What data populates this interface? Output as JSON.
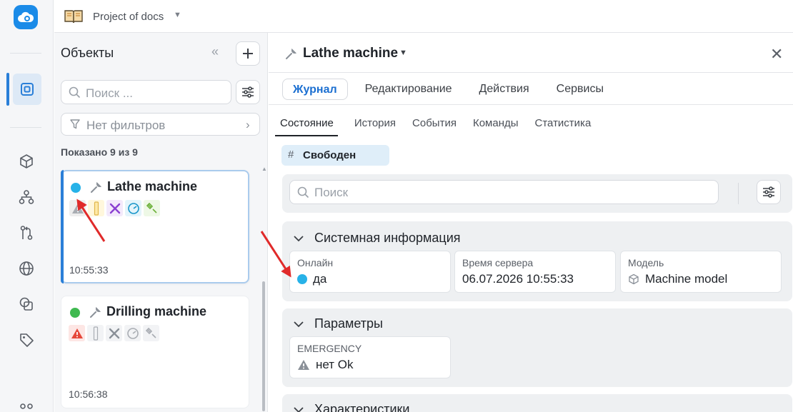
{
  "project": {
    "name": "Project of docs"
  },
  "objects_panel": {
    "title": "Объекты",
    "search_placeholder": "Поиск ...",
    "filters_label": "Нет фильтров",
    "shown_count": "Показано 9 из 9",
    "items": [
      {
        "name": "Lathe machine",
        "time": "10:55:33",
        "status_color": "#27b2e8",
        "selected": true
      },
      {
        "name": "Drilling machine",
        "time": "10:56:38",
        "status_color": "#3fb950",
        "selected": false
      }
    ]
  },
  "detail": {
    "title": "Lathe machine",
    "tabs": [
      {
        "label": "Журнал",
        "active": true
      },
      {
        "label": "Редактирование",
        "active": false
      },
      {
        "label": "Действия",
        "active": false
      },
      {
        "label": "Сервисы",
        "active": false
      }
    ],
    "subtabs": [
      {
        "label": "Состояние",
        "active": true
      },
      {
        "label": "История",
        "active": false
      },
      {
        "label": "События",
        "active": false
      },
      {
        "label": "Команды",
        "active": false
      },
      {
        "label": "Статистика",
        "active": false
      }
    ],
    "status_tag": {
      "hash": "#",
      "label": "Свободен"
    },
    "search_placeholder": "Поиск",
    "sections": {
      "system": {
        "title": "Системная информация",
        "fields": [
          {
            "label": "Онлайн",
            "value": "да"
          },
          {
            "label": "Время сервера",
            "value": "06.07.2026 10:55:33"
          },
          {
            "label": "Модель",
            "value": "Machine model"
          }
        ]
      },
      "params": {
        "title": "Параметры",
        "fields": [
          {
            "label": "EMERGENCY",
            "value": "нет Ok"
          }
        ]
      },
      "characteristics": {
        "title": "Характеристики"
      }
    }
  },
  "colors": {
    "accent": "#2a7fd8",
    "online_dot": "#27b2e8",
    "green_dot": "#3fb950",
    "annotation_arrow": "#e02a2a"
  }
}
